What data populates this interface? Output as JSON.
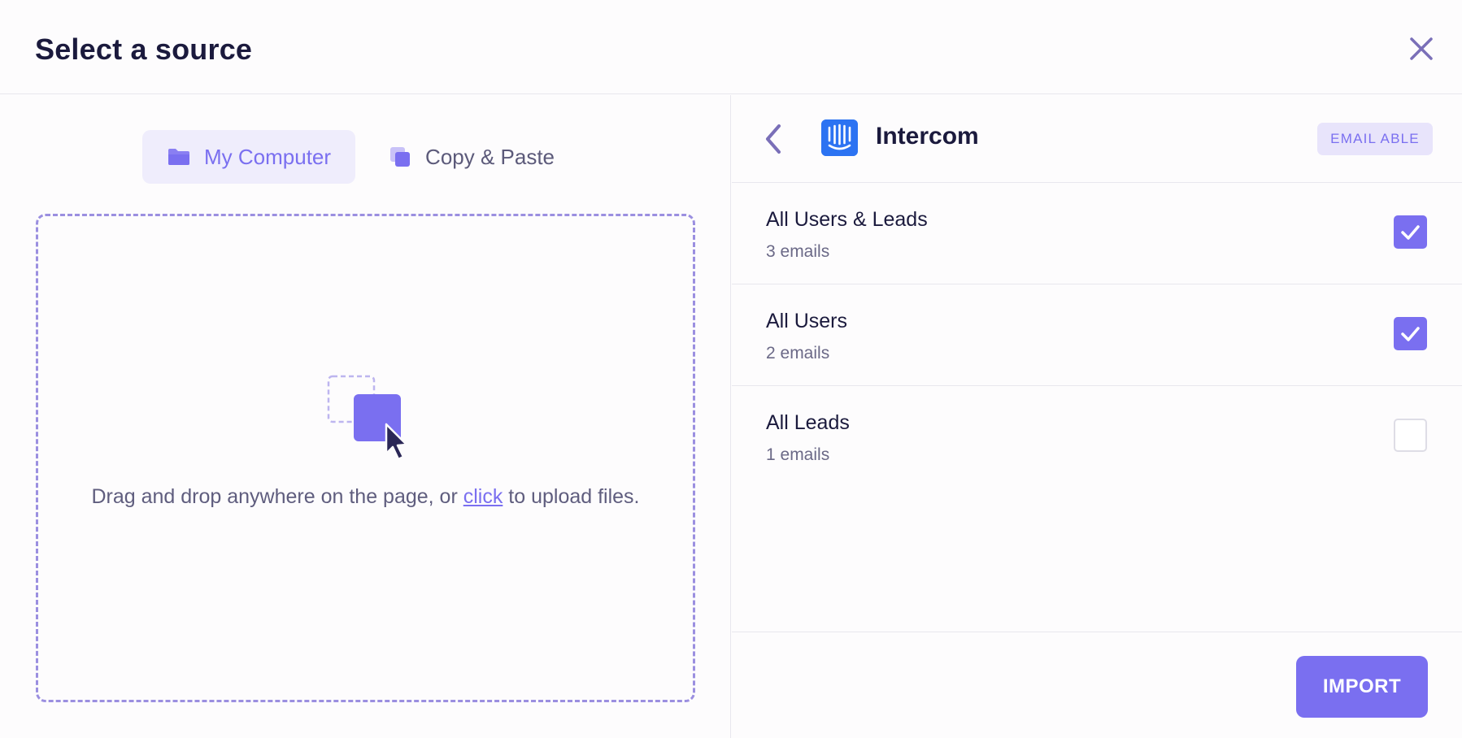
{
  "modal": {
    "title": "Select a source"
  },
  "tabs": [
    {
      "label": "My Computer",
      "icon": "folder-icon",
      "active": true
    },
    {
      "label": "Copy & Paste",
      "icon": "copy-icon",
      "active": false
    }
  ],
  "dropzone": {
    "text_before": "Drag and drop anywhere on the page, or ",
    "link": "click",
    "text_after": " to upload files."
  },
  "provider": {
    "name": "Intercom",
    "badge": "EMAIL ABLE",
    "icon": "intercom-logo"
  },
  "segments": [
    {
      "title": "All Users & Leads",
      "count": "3 emails",
      "checked": true
    },
    {
      "title": "All Users",
      "count": "2 emails",
      "checked": true
    },
    {
      "title": "All Leads",
      "count": "1 emails",
      "checked": false
    }
  ],
  "footer": {
    "import_label": "IMPORT"
  },
  "colors": {
    "accent": "#7a6ff0",
    "accent_light": "#efedfc",
    "intercom_blue": "#2c73f2",
    "title": "#1b1a3d"
  }
}
